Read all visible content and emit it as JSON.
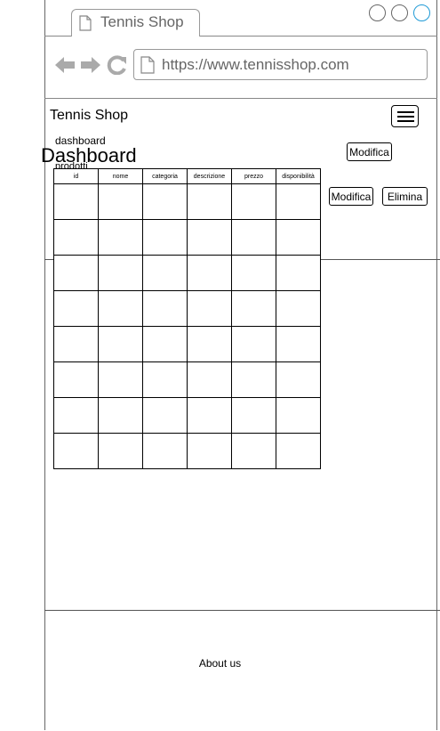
{
  "browser": {
    "tab_title": "Tennis Shop",
    "url": "https://www.tennisshop.com"
  },
  "header": {
    "brand": "Tennis Shop"
  },
  "breadcrumb": {
    "current": "dashboard",
    "sub": "prodotti"
  },
  "page": {
    "title": "Dashboard"
  },
  "actions": {
    "modify_top": "Modifica",
    "modify": "Modifica",
    "delete": "Elimina"
  },
  "table": {
    "columns": [
      "id",
      "nome",
      "categoria",
      "descrizione",
      "prezzo",
      "disponibilità"
    ],
    "row_count": 8
  },
  "footer": {
    "about": "About us"
  }
}
